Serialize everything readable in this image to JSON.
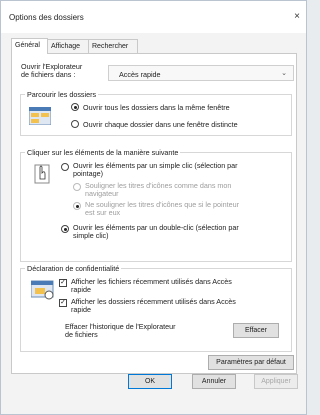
{
  "window": {
    "title": "Options des dossiers",
    "close_glyph": "×"
  },
  "tabs": [
    {
      "label": "Général",
      "active": true
    },
    {
      "label": "Affichage",
      "active": false
    },
    {
      "label": "Rechercher",
      "active": false
    }
  ],
  "general": {
    "open_explorer_label_1": "Ouvrir l'Explorateur",
    "open_explorer_label_2": "de fichiers dans :",
    "open_explorer_value": "Accès rapide",
    "browse_group": {
      "title": "Parcourir les dossiers",
      "option_same": "Ouvrir tous les dossiers dans la même fenêtre",
      "option_new": "Ouvrir chaque dossier dans une fenêtre distincte",
      "selected": "same"
    },
    "click_group": {
      "title": "Cliquer sur les éléments de la manière suivante",
      "single_line1": "Ouvrir les éléments par un simple clic (sélection par",
      "single_line2": "pointage)",
      "underline_always_1": "Souligner les titres d'icônes comme dans mon",
      "underline_always_2": "navigateur",
      "underline_hover_1": "Ne souligner les titres d'icônes que si le pointeur",
      "underline_hover_2": "est sur eux",
      "double_line1": "Ouvrir les éléments par un double-clic (sélection par",
      "double_line2": "simple clic)",
      "selected": "double"
    },
    "privacy_group": {
      "title": "Déclaration de confidentialité",
      "recent_files_1": "Afficher les fichiers récemment utilisés dans Accès",
      "recent_files_2": "rapide",
      "recent_files_checked": true,
      "recent_folders_1": "Afficher les dossiers récemment utilisés dans Accès",
      "recent_folders_2": "rapide",
      "recent_folders_checked": true,
      "clear_label_1": "Effacer l'historique de l'Explorateur",
      "clear_label_2": "de fichiers",
      "clear_button": "Effacer"
    },
    "defaults_button": "Paramètres par défaut"
  },
  "footer": {
    "ok": "OK",
    "cancel": "Annuler",
    "apply": "Appliquer"
  },
  "icons": [
    "folder-windows-icon",
    "pointer-hand-icon",
    "privacy-folder-icon"
  ]
}
